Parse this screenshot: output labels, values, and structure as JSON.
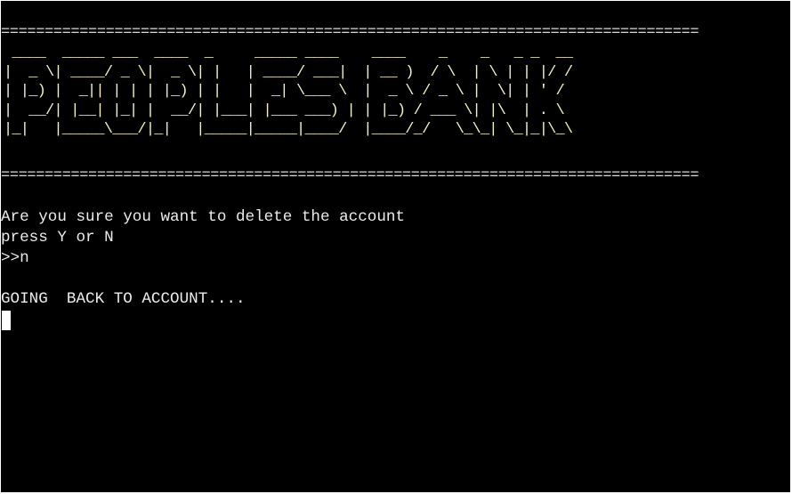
{
  "terminal": {
    "separator_top": "================================================================================",
    "banner_lines": [
      " ____  _____ ___  ____  _     _____ ____    ____    _    _   _ _  __",
      "|  _ \\| ____/ _ \\|  _ \\| |   | ____/ ___|  | __ )  / \\  | \\ | | |/ /",
      "| |_) |  _|| | | | |_) | |   |  _| \\___ \\  |  _ \\ / _ \\ |  \\| | ' / ",
      "|  __/| |__| |_| |  __/| |___| |___ ___) | | |_) / ___ \\| |\\  | . \\ ",
      "|_|   |_____\\___/|_|   |_____|_____|____/  |____/_/   \\_\\_| \\_|_|\\_\\"
    ],
    "separator_bottom": "================================================================================",
    "prompt_line": "Are you sure you want to delete the account",
    "instruction_line": "press Y or N",
    "input_line": ">>n",
    "status_line": "GOING  BACK TO ACCOUNT...."
  },
  "colors": {
    "background": "#000000",
    "text": "#ececec",
    "banner": "#f5f0c4"
  }
}
